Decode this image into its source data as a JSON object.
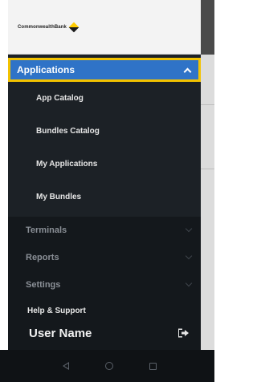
{
  "brand": {
    "logo_text": "CommonwealthBank"
  },
  "menu": {
    "applications": {
      "label": "Applications",
      "expanded": true,
      "items": [
        {
          "label": "App Catalog"
        },
        {
          "label": "Bundles Catalog"
        },
        {
          "label": "My Applications"
        },
        {
          "label": "My Bundles"
        }
      ]
    },
    "sections": [
      {
        "label": "Terminals"
      },
      {
        "label": "Reports"
      },
      {
        "label": "Settings"
      }
    ],
    "help_label": "Help & Support"
  },
  "user": {
    "name": "User Name"
  },
  "icons": {
    "expand_chevron": "chevron-up-icon",
    "collapse_chevron": "chevron-down-icon",
    "logout": "logout-icon",
    "nav_back": "back-triangle-icon",
    "nav_home": "home-circle-icon",
    "nav_recent": "recent-square-icon"
  },
  "colors": {
    "header_blue": "#2f73c7",
    "focus_yellow": "#f2c200",
    "drawer_bg": "#1c2126"
  }
}
